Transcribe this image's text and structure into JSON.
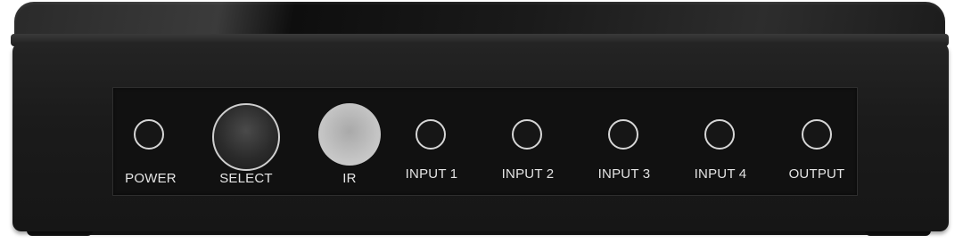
{
  "panel": {
    "power_label": "POWER",
    "select_label": "SELECT",
    "ir_label": "IR",
    "input1_label": "INPUT 1",
    "input2_label": "INPUT 2",
    "input3_label": "INPUT 3",
    "input4_label": "INPUT 4",
    "output_label": "OUTPUT"
  }
}
